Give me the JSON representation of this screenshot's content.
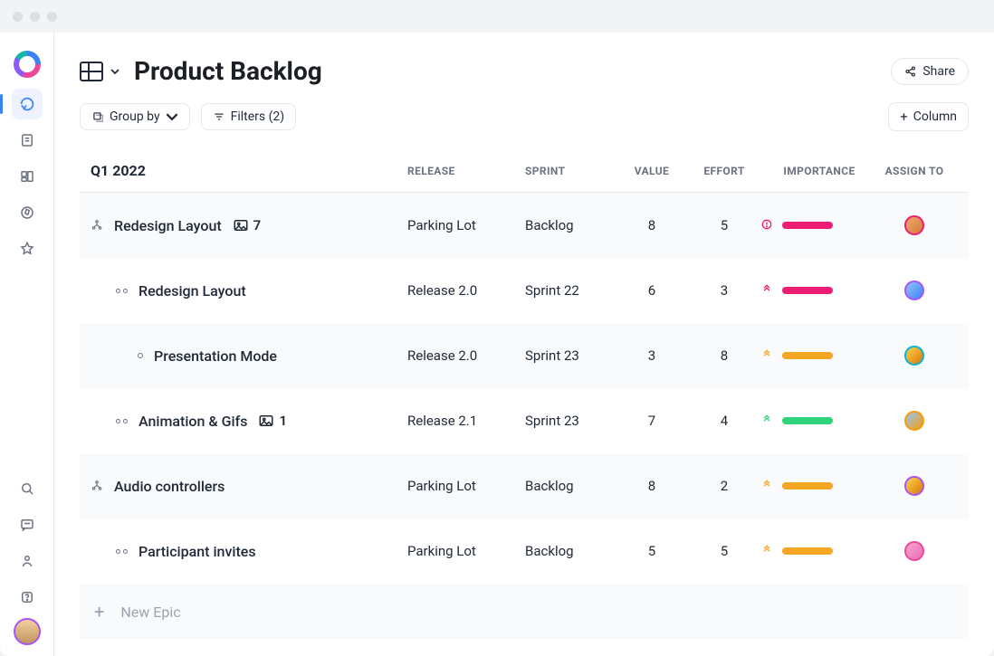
{
  "header": {
    "title": "Product Backlog",
    "share_label": "Share",
    "group_by_label": "Group by",
    "filters_label": "Filters (2)",
    "add_column_label": "Column"
  },
  "table": {
    "group_title": "Q1 2022",
    "columns": {
      "release": "RELEASE",
      "sprint": "SPRINT",
      "value": "VALUE",
      "effort": "EFFORT",
      "importance": "IMPORTANCE",
      "assign": "ASSIGN TO"
    },
    "rows": [
      {
        "name": "Redesign Layout",
        "attach": "7",
        "release": "Parking Lot",
        "sprint": "Backlog",
        "value": "8",
        "effort": "5"
      },
      {
        "name": "Redesign Layout",
        "release": "Release 2.0",
        "sprint": "Sprint 22",
        "value": "6",
        "effort": "3"
      },
      {
        "name": "Presentation Mode",
        "release": "Release 2.0",
        "sprint": "Sprint 23",
        "value": "3",
        "effort": "8"
      },
      {
        "name": "Animation & Gifs",
        "attach": "1",
        "release": "Release 2.1",
        "sprint": "Sprint 23",
        "value": "7",
        "effort": "4"
      },
      {
        "name": "Audio controllers",
        "release": "Parking Lot",
        "sprint": "Backlog",
        "value": "8",
        "effort": "2"
      },
      {
        "name": "Participant invites",
        "release": "Parking Lot",
        "sprint": "Backlog",
        "value": "5",
        "effort": "5"
      }
    ],
    "new_epic": "New Epic"
  }
}
